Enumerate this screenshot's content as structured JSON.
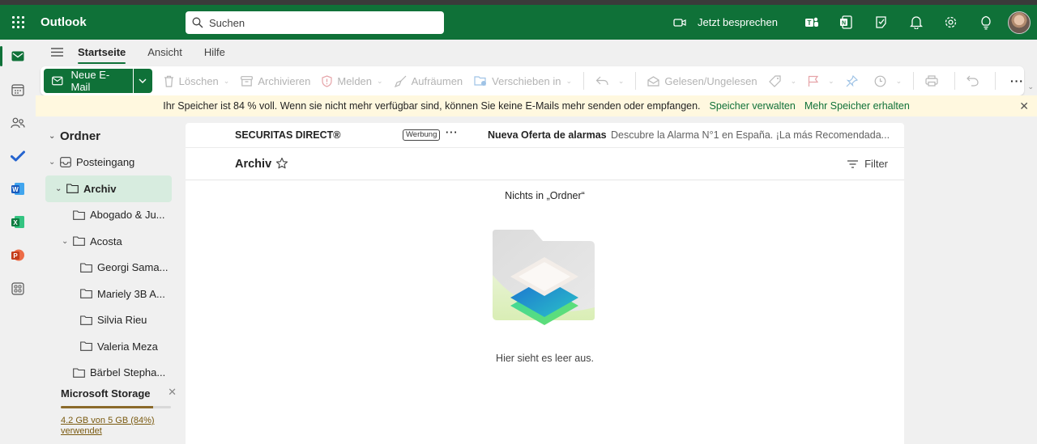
{
  "app": {
    "title": "Outlook"
  },
  "search": {
    "placeholder": "Suchen"
  },
  "header": {
    "meet_now": "Jetzt besprechen"
  },
  "ribbon": {
    "tabs": [
      {
        "label": "Startseite",
        "active": true
      },
      {
        "label": "Ansicht",
        "active": false
      },
      {
        "label": "Hilfe",
        "active": false
      }
    ]
  },
  "toolbar": {
    "new_mail": "Neue E-Mail",
    "delete": "Löschen",
    "archive": "Archivieren",
    "report": "Melden",
    "sweep": "Aufräumen",
    "move": "Verschieben in",
    "read_unread": "Gelesen/Ungelesen",
    "more": "···"
  },
  "banner": {
    "text": "Ihr Speicher ist 84 % voll. Wenn sie nicht mehr verfügbar sind, können Sie keine E-Mails mehr senden oder empfangen.",
    "link1": "Speicher verwalten",
    "link2": "Mehr Speicher erhalten"
  },
  "folders": {
    "root": "Ordner",
    "items": [
      {
        "label": "Posteingang"
      },
      {
        "label": "Archiv"
      },
      {
        "label": "Abogado & Ju..."
      },
      {
        "label": "Acosta"
      },
      {
        "label": "Georgi Sama..."
      },
      {
        "label": "Mariely 3B A..."
      },
      {
        "label": "Silvia Rieu"
      },
      {
        "label": "Valeria Meza"
      },
      {
        "label": "Bärbel Stepha..."
      }
    ]
  },
  "storage": {
    "title": "Microsoft Storage",
    "usage": "4.2 GB von 5 GB (84%) verwendet",
    "fraction": 0.84,
    "bar_color": "#8b6a2a"
  },
  "ad": {
    "sender": "SECURITAS DIRECT®",
    "badge": "Werbung",
    "more": "···",
    "subject": "Nueva Oferta de alarmas",
    "preview": "Descubre la Alarma N°1 en España. ¡La más Recomendada..."
  },
  "list": {
    "title": "Archiv",
    "filter": "Filter",
    "empty_title": "Nichts in „Ordner“",
    "empty_text": "Hier sieht es leer aus."
  },
  "colors": {
    "brand": "#0f7138",
    "banner_bg": "#fff8df",
    "selected_folder": "#d7ecdf"
  }
}
